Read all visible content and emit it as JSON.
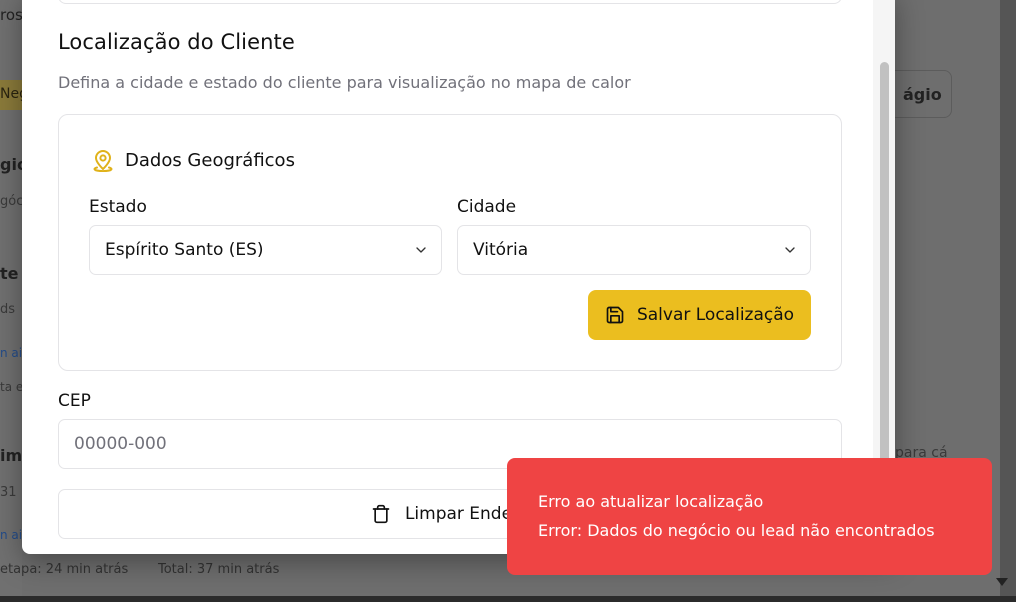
{
  "background": {
    "frag_top_left": "ros",
    "frag_tag": "Neg",
    "frag_gio": "gio",
    "frag_gocio": "góc",
    "frag_te": "te",
    "frag_ds": "ds",
    "frag_nai1": "n ai",
    "frag_ta_etap": "ta eta",
    "frag_im": "im",
    "frag_31": "31",
    "frag_nai2": "n ai",
    "frag_etapa_time": "etapa: 24 min atrás",
    "frag_total_time": "Total: 37 min atrás",
    "frag_button": "ágio",
    "frag_para_ca": "para cá"
  },
  "modal": {
    "section_title": "Localização do Cliente",
    "section_desc": "Defina a cidade e estado do cliente para visualização no mapa de calor",
    "geo": {
      "icon": "map-pin-icon",
      "title": "Dados Geográficos",
      "state_label": "Estado",
      "state_value": "Espírito Santo (ES)",
      "city_label": "Cidade",
      "city_value": "Vitória",
      "save_label": "Salvar Localização",
      "accent": "#ebbe1f"
    },
    "cep_label": "CEP",
    "cep_placeholder": "00000-000",
    "clear_label": "Limpar Ender"
  },
  "toast": {
    "title": "Erro ao atualizar localização",
    "message": "Error: Dados do negócio ou lead não encontrados",
    "color": "#ef4444"
  }
}
